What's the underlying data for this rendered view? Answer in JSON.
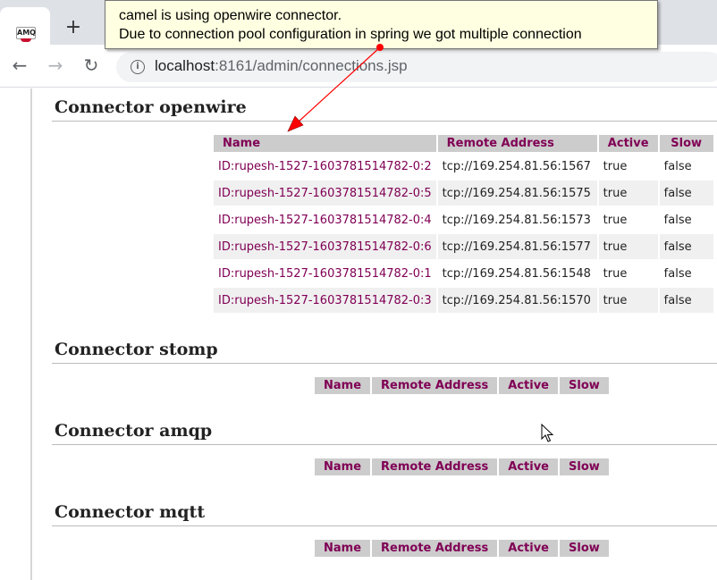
{
  "browser": {
    "tab_favicon_text": "AMQ",
    "new_tab_label": "+",
    "back_label": "←",
    "forward_label": "→",
    "reload_label": "↻",
    "info_label": "i",
    "url_host": "localhost",
    "url_rest": ":8161/admin/connections.jsp"
  },
  "tooltip": {
    "line1": "camel is using openwire connector.",
    "line2": "Due to connection pool configuration in spring we got multiple connection"
  },
  "columns": [
    "Name",
    "Remote Address",
    "Active",
    "Slow"
  ],
  "connectors": [
    {
      "title": "Connector openwire",
      "rows": [
        {
          "name": "ID:rupesh-1527-1603781514782-0:2",
          "remote": "tcp://169.254.81.56:1567",
          "active": "true",
          "slow": "false"
        },
        {
          "name": "ID:rupesh-1527-1603781514782-0:5",
          "remote": "tcp://169.254.81.56:1575",
          "active": "true",
          "slow": "false"
        },
        {
          "name": "ID:rupesh-1527-1603781514782-0:4",
          "remote": "tcp://169.254.81.56:1573",
          "active": "true",
          "slow": "false"
        },
        {
          "name": "ID:rupesh-1527-1603781514782-0:6",
          "remote": "tcp://169.254.81.56:1577",
          "active": "true",
          "slow": "false"
        },
        {
          "name": "ID:rupesh-1527-1603781514782-0:1",
          "remote": "tcp://169.254.81.56:1548",
          "active": "true",
          "slow": "false"
        },
        {
          "name": "ID:rupesh-1527-1603781514782-0:3",
          "remote": "tcp://169.254.81.56:1570",
          "active": "true",
          "slow": "false"
        }
      ]
    },
    {
      "title": "Connector stomp",
      "rows": []
    },
    {
      "title": "Connector amqp",
      "rows": []
    },
    {
      "title": "Connector mqtt",
      "rows": []
    }
  ],
  "colors": {
    "link": "#800055",
    "header_bg": "#cccccc",
    "tooltip_bg": "#ffffe1",
    "arrow": "#ff0000"
  }
}
